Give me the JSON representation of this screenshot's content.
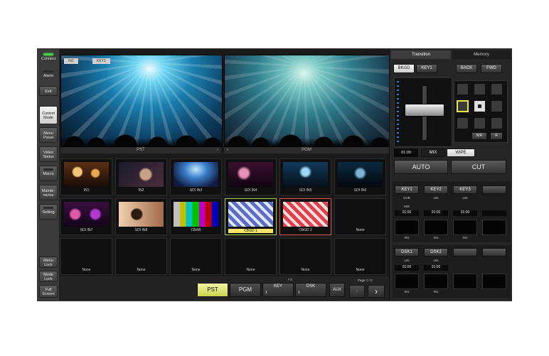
{
  "sidebar": {
    "items": [
      {
        "label": "Connect",
        "led": true
      },
      {
        "label": "Alarm",
        "led": false
      },
      {
        "label": "Exit"
      },
      {
        "label": "Control Mode",
        "active": true
      },
      {
        "label": "Menu Panel"
      },
      {
        "label": "Video Status"
      },
      {
        "label": "Macro"
      },
      {
        "label": "Mainte-nance"
      },
      {
        "label": "Setting"
      },
      {
        "label": "Menu Lock"
      },
      {
        "label": "Mode Lock"
      },
      {
        "label": "Full Screen"
      }
    ]
  },
  "preview": {
    "pst_tags": [
      "IN1",
      "KEY1"
    ],
    "pst_label": "PST",
    "pgm_label": "PGM"
  },
  "sources": [
    {
      "label": "IN1",
      "thumb": "band-stage"
    },
    {
      "label": "IN2",
      "thumb": "guitarist"
    },
    {
      "label": "SDI IN3",
      "thumb": "concert-lights"
    },
    {
      "label": "SDI IN4",
      "thumb": "stage-singer"
    },
    {
      "label": "SDI IN5",
      "thumb": "band-stage-blue"
    },
    {
      "label": "SDI IN6",
      "thumb": "singer-blue"
    },
    {
      "label": "SDI IN7",
      "thumb": "dancers"
    },
    {
      "label": "SDI IN8",
      "thumb": "guitarist-warm"
    },
    {
      "label": "CBAR",
      "thumb": "color-bars"
    },
    {
      "label": "CBGD 1",
      "thumb": "stripes-blue",
      "state": "pst"
    },
    {
      "label": "CBGD 2",
      "thumb": "stripes-red",
      "state": "pgm"
    },
    {
      "label": "None",
      "thumb": "empty"
    },
    {
      "label": "None",
      "thumb": "empty"
    },
    {
      "label": "None",
      "thumb": "empty"
    },
    {
      "label": "None",
      "thumb": "empty"
    },
    {
      "label": "None",
      "thumb": "empty"
    },
    {
      "label": "None",
      "thumb": "empty"
    },
    {
      "label": "None",
      "thumb": "empty"
    }
  ],
  "bottom": {
    "pst": "PST",
    "pgm": "PGM",
    "fill_label": "Fill",
    "key": "KEY",
    "key_num": "1",
    "dsk": "DSK",
    "dsk_num": "1",
    "aux": "AUX",
    "page": "Page 1 / 2"
  },
  "right": {
    "tabs": [
      "Transition",
      "Memory"
    ],
    "bkgd": "BKGD",
    "key1": "KEY1",
    "back": "BACK",
    "fwd": "FWD",
    "nr": "N/R",
    "r": "R",
    "time": "01:00",
    "mix": "MIX",
    "wipe": "WIPE",
    "auto": "AUTO",
    "cut": "CUT",
    "keys": [
      {
        "name": "KEY1",
        "t1": "CHR",
        "t2": "MIX",
        "time": "01:00",
        "src": "IN1"
      },
      {
        "name": "KEY2",
        "t1": "LIN",
        "t2": "",
        "time": "01:00",
        "src": "IN1"
      },
      {
        "name": "KEY3",
        "t1": "LIN",
        "t2": "",
        "time": "01:00",
        "src": "IN1"
      },
      {
        "name": "",
        "t1": "",
        "t2": "",
        "time": "",
        "src": ""
      }
    ],
    "dsks": [
      {
        "name": "DSK1",
        "t1": "LIN",
        "time": "01:00",
        "src": "IN1"
      },
      {
        "name": "DSK2",
        "t1": "LIN",
        "time": "01:00",
        "src": "IN1"
      },
      {
        "name": "",
        "t1": "",
        "time": "",
        "src": ""
      },
      {
        "name": "",
        "t1": "",
        "time": "",
        "src": ""
      }
    ]
  },
  "colors": {
    "accent_pst": "#c9d24c",
    "pgm_red": "#e05050",
    "led_green": "#49d24c"
  }
}
